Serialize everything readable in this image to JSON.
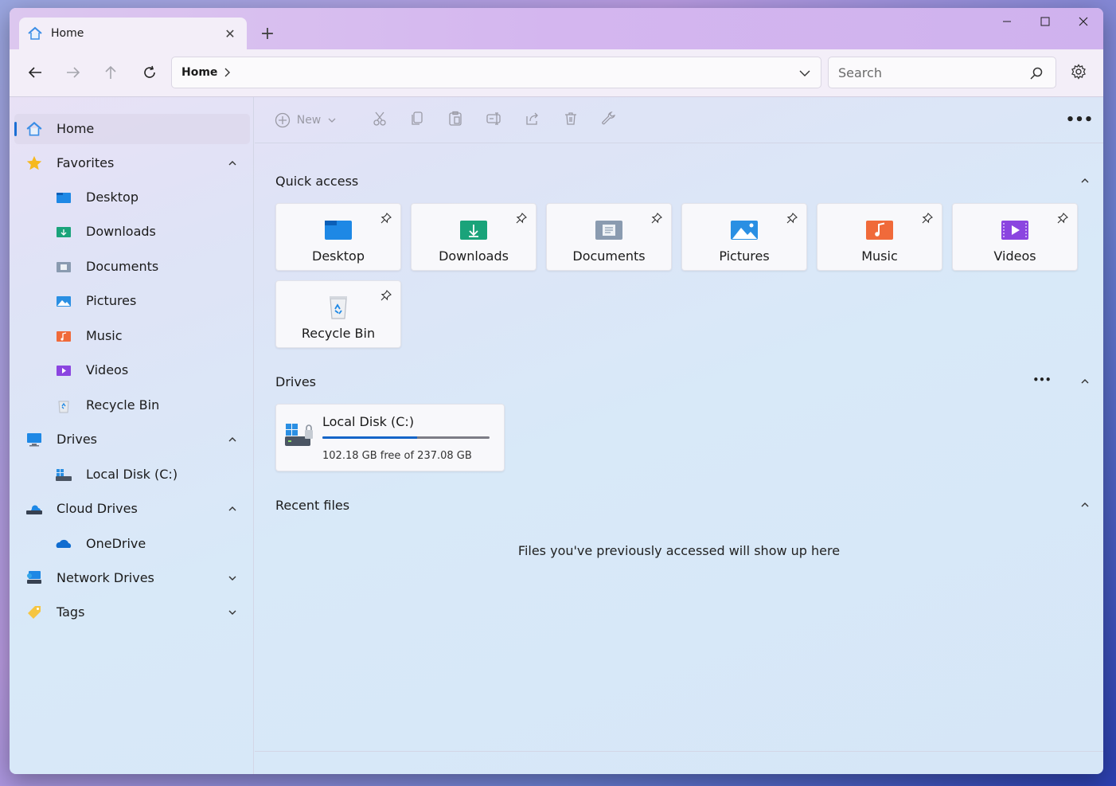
{
  "tab": {
    "title": "Home"
  },
  "address": {
    "crumb": "Home"
  },
  "search": {
    "placeholder": "Search"
  },
  "commands": {
    "new_label": "New"
  },
  "sidebar": {
    "items": [
      {
        "label": "Home",
        "icon": "home-icon"
      },
      {
        "label": "Favorites",
        "icon": "star-icon"
      },
      {
        "label": "Desktop",
        "icon": "desktop-folder-icon"
      },
      {
        "label": "Downloads",
        "icon": "downloads-folder-icon"
      },
      {
        "label": "Documents",
        "icon": "documents-folder-icon"
      },
      {
        "label": "Pictures",
        "icon": "pictures-folder-icon"
      },
      {
        "label": "Music",
        "icon": "music-folder-icon"
      },
      {
        "label": "Videos",
        "icon": "videos-folder-icon"
      },
      {
        "label": "Recycle Bin",
        "icon": "recycle-bin-icon"
      },
      {
        "label": "Drives",
        "icon": "monitor-icon"
      },
      {
        "label": "Local Disk (C:)",
        "icon": "local-disk-icon"
      },
      {
        "label": "Cloud Drives",
        "icon": "cloud-drive-icon"
      },
      {
        "label": "OneDrive",
        "icon": "onedrive-icon"
      },
      {
        "label": "Network Drives",
        "icon": "network-drive-icon"
      },
      {
        "label": "Tags",
        "icon": "tag-icon"
      }
    ]
  },
  "sections": {
    "quick_access": "Quick access",
    "drives": "Drives",
    "recent": "Recent files"
  },
  "quick_access": [
    {
      "label": "Desktop",
      "color": "#1e88e5"
    },
    {
      "label": "Downloads",
      "color": "#1aa37a"
    },
    {
      "label": "Documents",
      "color": "#8a9bb0"
    },
    {
      "label": "Pictures",
      "color": "#2a8fe3"
    },
    {
      "label": "Music",
      "color": "#f06a3a"
    },
    {
      "label": "Videos",
      "color": "#8b45e0"
    },
    {
      "label": "Recycle Bin",
      "color": "#cfd3d8"
    }
  ],
  "drive": {
    "name": "Local Disk (C:)",
    "free_text": "102.18 GB free of 237.08 GB",
    "used_fraction": 0.569
  },
  "recent": {
    "empty_message": "Files you've previously accessed will show up here"
  },
  "colors": {
    "accent": "#1b6fd4"
  }
}
